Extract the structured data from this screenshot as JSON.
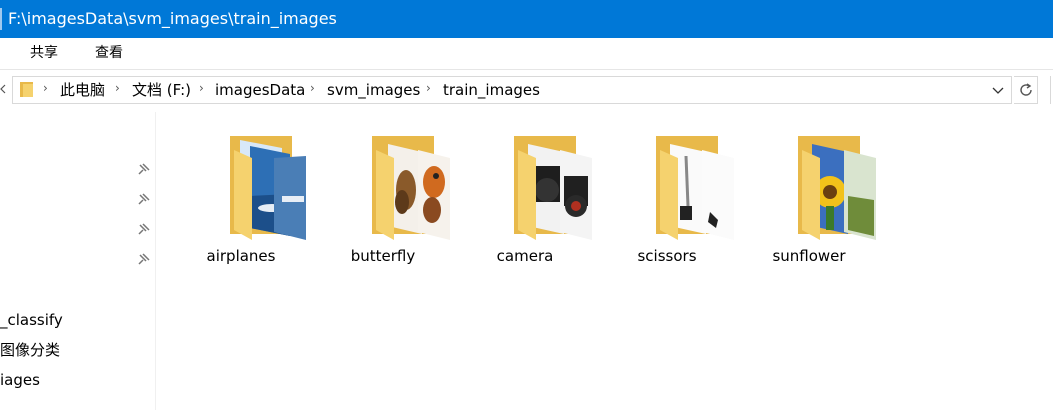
{
  "window": {
    "title": "F:\\imagesData\\svm_images\\train_images"
  },
  "ribbon": {
    "tabs": [
      {
        "label": "共享"
      },
      {
        "label": "查看"
      }
    ]
  },
  "address": {
    "crumbs": [
      "此电脑",
      "文档 (F:)",
      "imagesData",
      "svm_images",
      "train_images"
    ]
  },
  "nav": {
    "items": [
      {
        "label": "_classify"
      },
      {
        "label": "图像分类"
      },
      {
        "label": "iages"
      }
    ]
  },
  "folders": [
    {
      "name": "airplanes",
      "icon": "folder-airplanes-icon"
    },
    {
      "name": "butterfly",
      "icon": "folder-butterfly-icon"
    },
    {
      "name": "camera",
      "icon": "folder-camera-icon"
    },
    {
      "name": "scissors",
      "icon": "folder-scissors-icon"
    },
    {
      "name": "sunflower",
      "icon": "folder-sunflower-icon"
    }
  ],
  "colors": {
    "titlebar": "#0078d7",
    "folder": "#f5d26e",
    "folder_back": "#e8b94a"
  }
}
